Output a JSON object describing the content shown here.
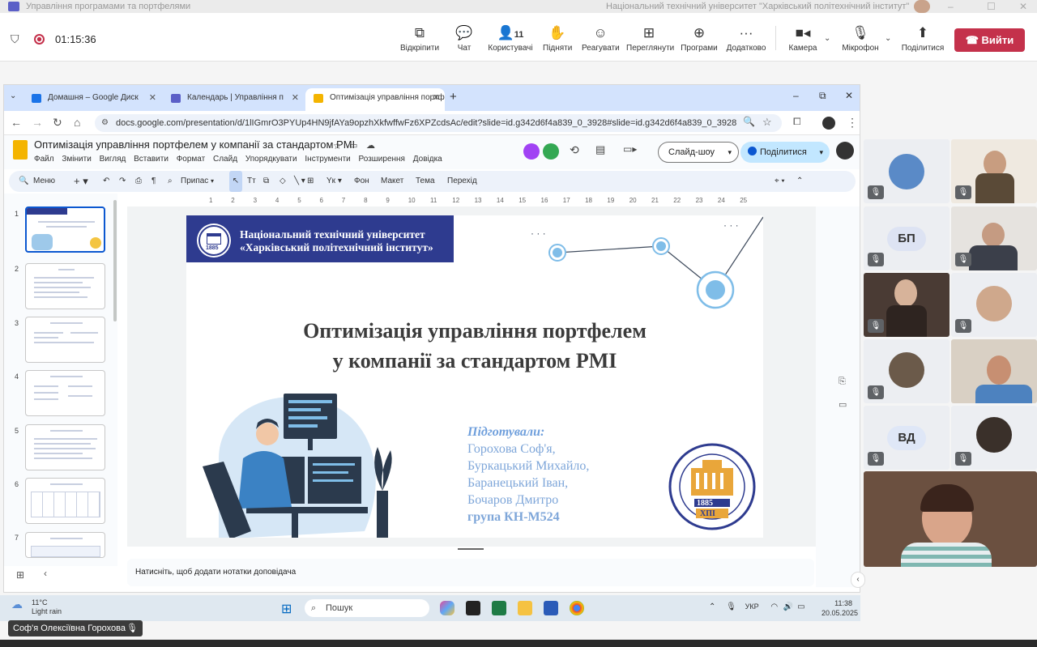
{
  "teams": {
    "window_title": "Управління програмами та портфелями",
    "org_name": "Національний технічний університет \"Харківський політехнічний інститут\"",
    "timer": "01:15:36",
    "toolbar": [
      {
        "name": "popout",
        "label": "Відкріпити",
        "icon": "popout-icon"
      },
      {
        "name": "chat",
        "label": "Чат",
        "icon": "chat-icon"
      },
      {
        "name": "people",
        "label": "Користувачі",
        "icon": "people-icon",
        "count": "11"
      },
      {
        "name": "raise",
        "label": "Підняти",
        "icon": "hand-icon"
      },
      {
        "name": "react",
        "label": "Реагувати",
        "icon": "smile-icon"
      },
      {
        "name": "view",
        "label": "Переглянути",
        "icon": "grid-icon"
      },
      {
        "name": "apps",
        "label": "Програми",
        "icon": "plus-box-icon"
      },
      {
        "name": "more",
        "label": "Додатково",
        "icon": "more-icon"
      },
      {
        "name": "camera",
        "label": "Камера",
        "icon": "camera-icon"
      },
      {
        "name": "mic",
        "label": "Мікрофон",
        "icon": "mic-icon"
      },
      {
        "name": "share",
        "label": "Поділитися",
        "icon": "share-icon"
      }
    ],
    "leave_label": "Вийти",
    "leave_color": "#c4314b",
    "presenter_name": "Соф'я Олексіївна Горохова"
  },
  "browser": {
    "tabs": [
      {
        "title": "Домашня – Google Диск",
        "color": "#1a73e8"
      },
      {
        "title": "Календарь | Управління п",
        "color": "#5b5fc7"
      },
      {
        "title": "Оптимізація управління портф",
        "color": "#f4b400"
      }
    ],
    "url": "docs.google.com/presentation/d/1lIGmrO3PYUp4HN9jfAYa9opzhXkfwffwFz6XPZcdsAc/edit?slide=id.g342d6f4a839_0_3928#slide=id.g342d6f4a839_0_3928"
  },
  "slides_app": {
    "doc_title": "Оптимізація управління портфелем у компанії за стандартом PMI",
    "menu": [
      "Файл",
      "Змінити",
      "Вигляд",
      "Вставити",
      "Формат",
      "Слайд",
      "Упорядкувати",
      "Інструменти",
      "Розширення",
      "Довідка"
    ],
    "slideshow_label": "Слайд-шоу",
    "share_label": "Поділитися",
    "format_toolbar": {
      "menu": "Меню",
      "fit": "Припас",
      "bg": "Фон",
      "layout": "Макет",
      "theme": "Тема",
      "transition": "Перехід"
    },
    "ruler": [
      "1",
      "2",
      "3",
      "4",
      "5",
      "6",
      "7",
      "8",
      "9",
      "10",
      "11",
      "12",
      "13",
      "14",
      "15",
      "16",
      "17",
      "18",
      "19",
      "20",
      "21",
      "22",
      "23",
      "24",
      "25"
    ],
    "thumb_numbers": [
      "1",
      "2",
      "3",
      "4",
      "5",
      "6",
      "7"
    ],
    "notes_placeholder": "Натисніть, щоб додати нотатки доповідача"
  },
  "slide": {
    "uni_line1": "Національний технічний університет",
    "uni_line2": "«Харківський політехнічний інститут»",
    "seal_year": "1885",
    "title_line1": "Оптимізація управління портфелем",
    "title_line2": "у компанії за стандартом PMI",
    "prepared_by": "Підготували:",
    "authors": [
      "Горохова Соф'я,",
      "Буркацький Михайло,",
      "Баранецький Іван,",
      "Бочаров Дмитро"
    ],
    "group": "група КН-М524",
    "khpi_ring": "НАЦІОНАЛЬНИЙ ТЕХНІЧНИЙ УНІВЕРСИТЕТ · ХАРКІВСЬКИЙ ПОЛІТЕХНІЧНИЙ ІНСТИТУТ",
    "khpi_year": "1885",
    "khpi_abbr": "ХПІ",
    "band_color": "#2e3b8f"
  },
  "participants": [
    {
      "initials": "",
      "type": "avatar"
    },
    {
      "initials": "",
      "type": "video"
    },
    {
      "initials": "БП",
      "type": "initials",
      "color": "#dde3f3"
    },
    {
      "initials": "",
      "type": "video"
    },
    {
      "initials": "",
      "type": "video"
    },
    {
      "initials": "",
      "type": "avatar"
    },
    {
      "initials": "",
      "type": "avatar"
    },
    {
      "initials": "",
      "type": "video"
    },
    {
      "initials": "ВД",
      "type": "initials",
      "color": "#dfe7f7"
    },
    {
      "initials": "",
      "type": "avatar"
    }
  ],
  "taskbar": {
    "temp": "11°C",
    "weather": "Light rain",
    "search": "Пошук",
    "lang": "УКР",
    "time": "11:38",
    "date": "20.05.2025"
  }
}
